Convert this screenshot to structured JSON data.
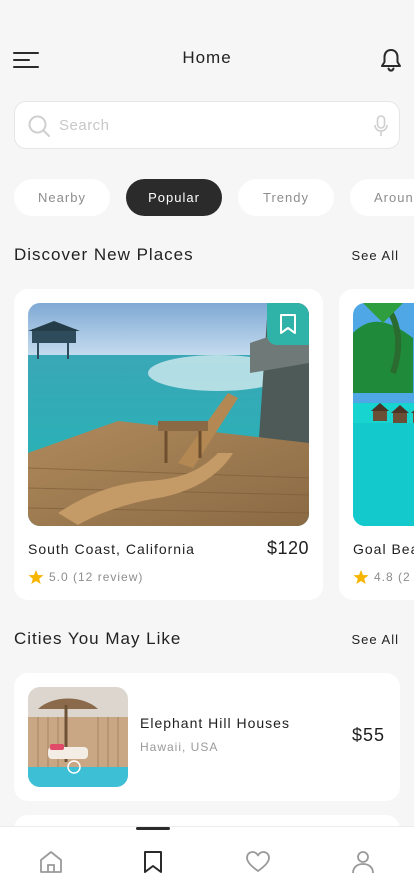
{
  "header": {
    "title": "Home",
    "menu_icon": "menu-icon",
    "bell_icon": "bell-icon"
  },
  "search": {
    "placeholder": "Search",
    "value": "",
    "search_icon": "search-icon",
    "mic_icon": "mic-icon"
  },
  "filters": [
    {
      "label": "Nearby",
      "active": false
    },
    {
      "label": "Popular",
      "active": true
    },
    {
      "label": "Trendy",
      "active": false
    },
    {
      "label": "Aroun",
      "active": false
    }
  ],
  "discover": {
    "title": "Discover New Places",
    "see_all": "See All",
    "places": [
      {
        "name": "South Coast, California",
        "price": "$120",
        "rating": "5.0 (12 review)",
        "bookmark_icon": "bookmark-icon"
      },
      {
        "name": "Goal Bea",
        "price": "",
        "rating": "4.8 (2",
        "bookmark_icon": "bookmark-icon"
      }
    ]
  },
  "cities": {
    "title": "Cities You May Like",
    "see_all": "See All",
    "items": [
      {
        "name": "Elephant Hill Houses",
        "location": "Hawaii, USA",
        "price": "$55"
      }
    ]
  },
  "tabbar": {
    "items": [
      {
        "icon": "home-icon",
        "active": false
      },
      {
        "icon": "bookmark-icon",
        "active": true
      },
      {
        "icon": "heart-icon",
        "active": false
      },
      {
        "icon": "profile-icon",
        "active": false
      }
    ]
  },
  "colors": {
    "accent": "#2fb3a8",
    "dark": "#2b2b2b",
    "background": "#f6f6f6",
    "star": "#f7b500"
  }
}
